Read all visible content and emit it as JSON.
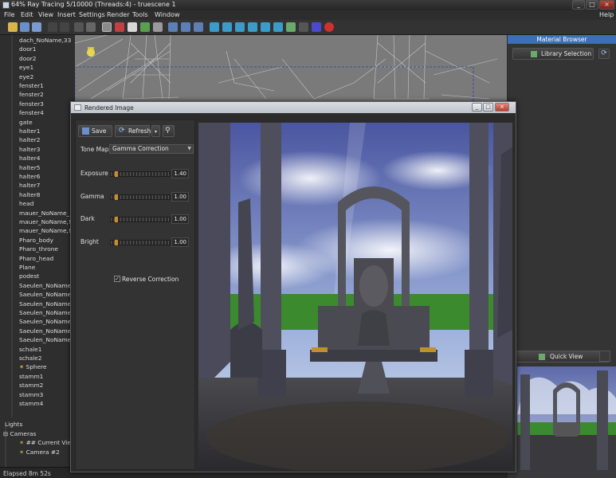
{
  "titlebar": {
    "title": "64% Ray Tracing 5/10000 (Threads:4) - truescene 1",
    "minimize": "_",
    "restore": "□",
    "close": "×"
  },
  "menu": [
    "File",
    "Edit",
    "View",
    "Insert",
    "Settings",
    "Render",
    "Tools",
    "Window"
  ],
  "help": "Help",
  "tree": {
    "items": [
      "dach_NoName,33",
      "door1",
      "door2",
      "eye1",
      "eye2",
      "fenster1",
      "fenster2",
      "fenster3",
      "fenster4",
      "gate",
      "halter1",
      "halter2",
      "halter3",
      "halter4",
      "halter5",
      "halter6",
      "halter7",
      "halter8",
      "head",
      "mauer_NoName_",
      "mauer_NoName,!",
      "mauer_NoName,!",
      "Pharo_body",
      "Pharo_throne",
      "Pharo_head",
      "Plane",
      "podest",
      "Saeulen_NoName",
      "Saeulen_NoName",
      "Saeulen_NoName",
      "Saeulen_NoName",
      "Saeulen_NoName",
      "Saeulen_NoName",
      "Saeulen_NoName",
      "schale1",
      "schale2",
      "Sphere",
      "stamm1",
      "stamm2",
      "stamm3",
      "stamm4"
    ],
    "lights": "Lights",
    "cameras": "Cameras",
    "current_view": "## Current Vie",
    "camera2": "Camera #2"
  },
  "status": "Elapsed 8m 52s",
  "right_panel": {
    "header": "Material Browser",
    "library_button": "Library Selection",
    "quick_view": "Quick View"
  },
  "render_window": {
    "title": "Rendered Image",
    "save": "Save",
    "refresh": "Refresh",
    "tone_map_label": "Tone Map",
    "tone_map_value": "Gamma Correction",
    "params": [
      {
        "label": "Exposure",
        "value": "1.40",
        "fraction": 0.07
      },
      {
        "label": "Gamma",
        "value": "1.00",
        "fraction": 0.07
      },
      {
        "label": "Dark",
        "value": "1.00",
        "fraction": 0.07
      },
      {
        "label": "Bright",
        "value": "1.00",
        "fraction": 0.07
      }
    ],
    "reverse_correction": "Reverse Correction",
    "reverse_checked": true
  },
  "colors": {
    "accent": "#3d6fb8",
    "slider_knob": "#d08a2e",
    "panel": "#333333"
  }
}
